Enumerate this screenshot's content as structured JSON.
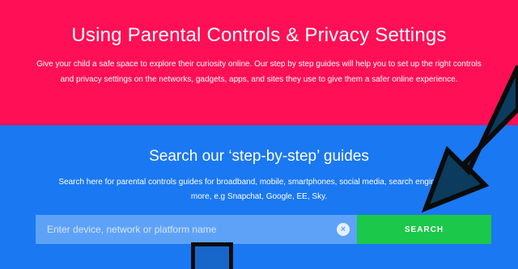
{
  "hero": {
    "title": "Using Parental Controls & Privacy Settings",
    "description": "Give your child a safe space to explore their curiosity online. Our step by step guides will help you to set up the right controls and privacy settings on the networks, gadgets, apps, and sites they use to give them a safer online experience."
  },
  "search": {
    "title": "Search our ‘step-by-step’ guides",
    "description": "Search here for parental controls guides for broadband, mobile, smartphones, social media, search engines and more, e.g Snapchat, Google, EE, Sky.",
    "placeholder": "Enter device, network or platform name",
    "clear_label": "×",
    "button_label": "SEARCH"
  },
  "colors": {
    "hero_bg": "#ff0f55",
    "section_bg": "#1a78f2",
    "input_bg": "#5ea2f8",
    "button_bg": "#1bc849",
    "arrow_fill": "#0b3c5d",
    "arrow_stroke": "#0b0b0b"
  },
  "icons": {
    "clear": "close-circle-icon",
    "overlay": "pointer-arrow-icon"
  }
}
